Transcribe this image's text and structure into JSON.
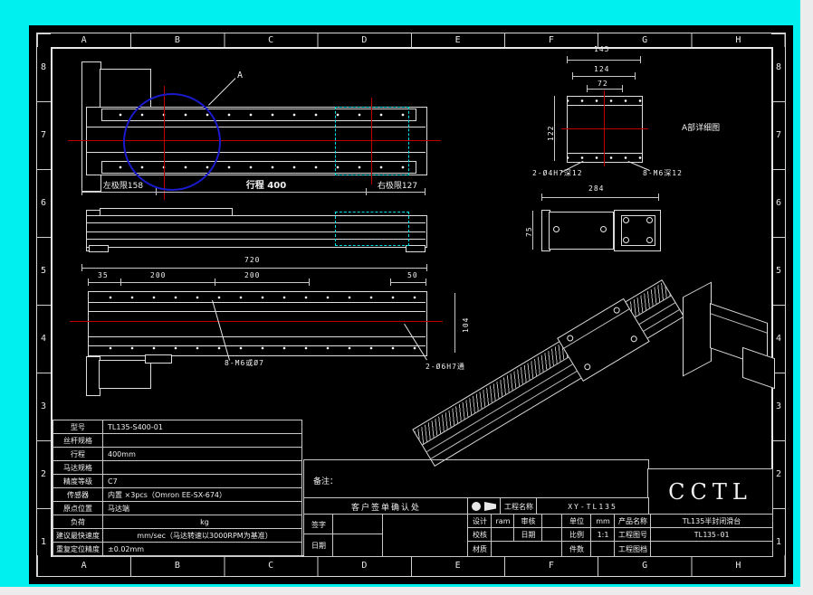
{
  "zones": {
    "letters": [
      "A",
      "B",
      "C",
      "D",
      "E",
      "F",
      "G",
      "H"
    ],
    "numbers": [
      "8",
      "7",
      "6",
      "5",
      "4",
      "3",
      "2",
      "1"
    ]
  },
  "colors": {
    "margin": "#00f0f0",
    "line": "#ffffff",
    "centerline": "#c00000",
    "detail_circle": "#1a1acd",
    "highlight": "#00e5e5"
  },
  "top_view": {
    "detail_marker": "A",
    "dim_left": "左极限158",
    "dim_stroke": "行程 400",
    "dim_right": "右极限127"
  },
  "detail_view": {
    "caption": "A部详细图",
    "dim_145": "145",
    "dim_124": "124",
    "dim_72": "72",
    "dim_122": "122",
    "label_left": "2-Ø4H7深12",
    "label_right": "8-M6深12"
  },
  "end_view": {
    "dim_284": "284",
    "dim_75": "75"
  },
  "bottom_view": {
    "dim_total": "720",
    "dim_35": "35",
    "dim_200a": "200",
    "dim_200b": "200",
    "dim_50": "50",
    "dim_104": "104",
    "label_holes_bottom": "8-M6或Ø7",
    "label_holes_through": "2-Ø6H7通"
  },
  "notes": {
    "label": "备注："
  },
  "spec_table": {
    "rows": [
      {
        "label": "型号",
        "value": "TL135-S400-01"
      },
      {
        "label": "丝杆规格",
        "value": ""
      },
      {
        "label": "行程",
        "value": "400mm"
      },
      {
        "label": "马达规格",
        "value": ""
      },
      {
        "label": "精度等级",
        "value": "C7"
      },
      {
        "label": "传感器",
        "value": "内置 ×3pcs（Omron EE-SX-674）"
      },
      {
        "label": "原点位置",
        "value": "马达端"
      },
      {
        "label": "负荷",
        "value": "kg"
      },
      {
        "label": "建议最快速度",
        "value": "mm/sec（马达转速以3000RPM为基准）"
      },
      {
        "label": "重复定位精度",
        "value": "±0.02mm"
      }
    ]
  },
  "customer_block": {
    "title": "客户签单确认处",
    "sign_label": "签字",
    "date_label": "日期"
  },
  "title_block": {
    "logo": "CCTL",
    "project_label": "工程名称",
    "project_value": "XY-TL135",
    "design_label": "设计",
    "design_value": "ram",
    "review_label": "审核",
    "review_value": "",
    "unit_label": "单位",
    "unit_value": "mm",
    "product_label": "产品名称",
    "product_value": "TL135半封闭滑台",
    "check_label": "校核",
    "check_value": "",
    "date_label": "日期",
    "date_value": "",
    "scale_label": "比例",
    "scale_value": "1:1",
    "drawing_no_label": "工程图号",
    "drawing_no_value": "TL135-01",
    "material_label": "材质",
    "material_value": "",
    "qty_label": "件数",
    "qty_value": "",
    "file_label": "工程图档",
    "file_value": ""
  }
}
